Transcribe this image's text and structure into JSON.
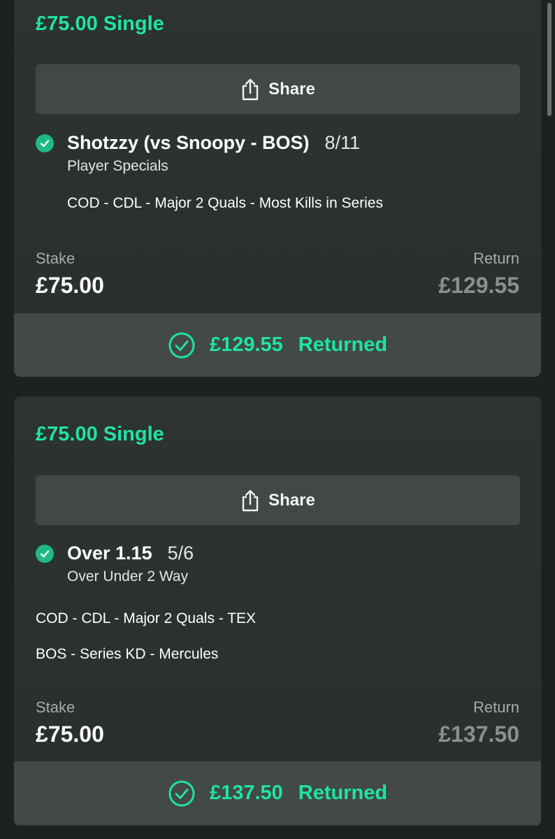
{
  "bets": [
    {
      "title": "£75.00 Single",
      "share_label": "Share",
      "selection": {
        "name": "Shotzzy (vs Snoopy - BOS)",
        "odds": "8/11",
        "market": "Player Specials",
        "event_lines": [
          "COD - CDL - Major 2 Quals - Most Kills in Series"
        ],
        "status_icon": "check-circle-icon"
      },
      "stake_label": "Stake",
      "stake_value": "£75.00",
      "return_label": "Return",
      "return_value": "£129.55",
      "returned_amount": "£129.55",
      "returned_label": "Returned"
    },
    {
      "title": "£75.00 Single",
      "share_label": "Share",
      "selection": {
        "name": "Over 1.15",
        "odds": "5/6",
        "market": "Over Under 2 Way",
        "event_lines": [
          "COD - CDL - Major 2 Quals - TEX",
          "BOS - Series KD - Mercules"
        ],
        "status_icon": "check-circle-icon"
      },
      "stake_label": "Stake",
      "stake_value": "£75.00",
      "return_label": "Return",
      "return_value": "£137.50",
      "returned_amount": "£137.50",
      "returned_label": "Returned"
    }
  ],
  "colors": {
    "accent": "#1fe3a5",
    "check": "#1fb985",
    "card": "#2d3332",
    "background": "#1d2120",
    "panel": "#434947"
  }
}
